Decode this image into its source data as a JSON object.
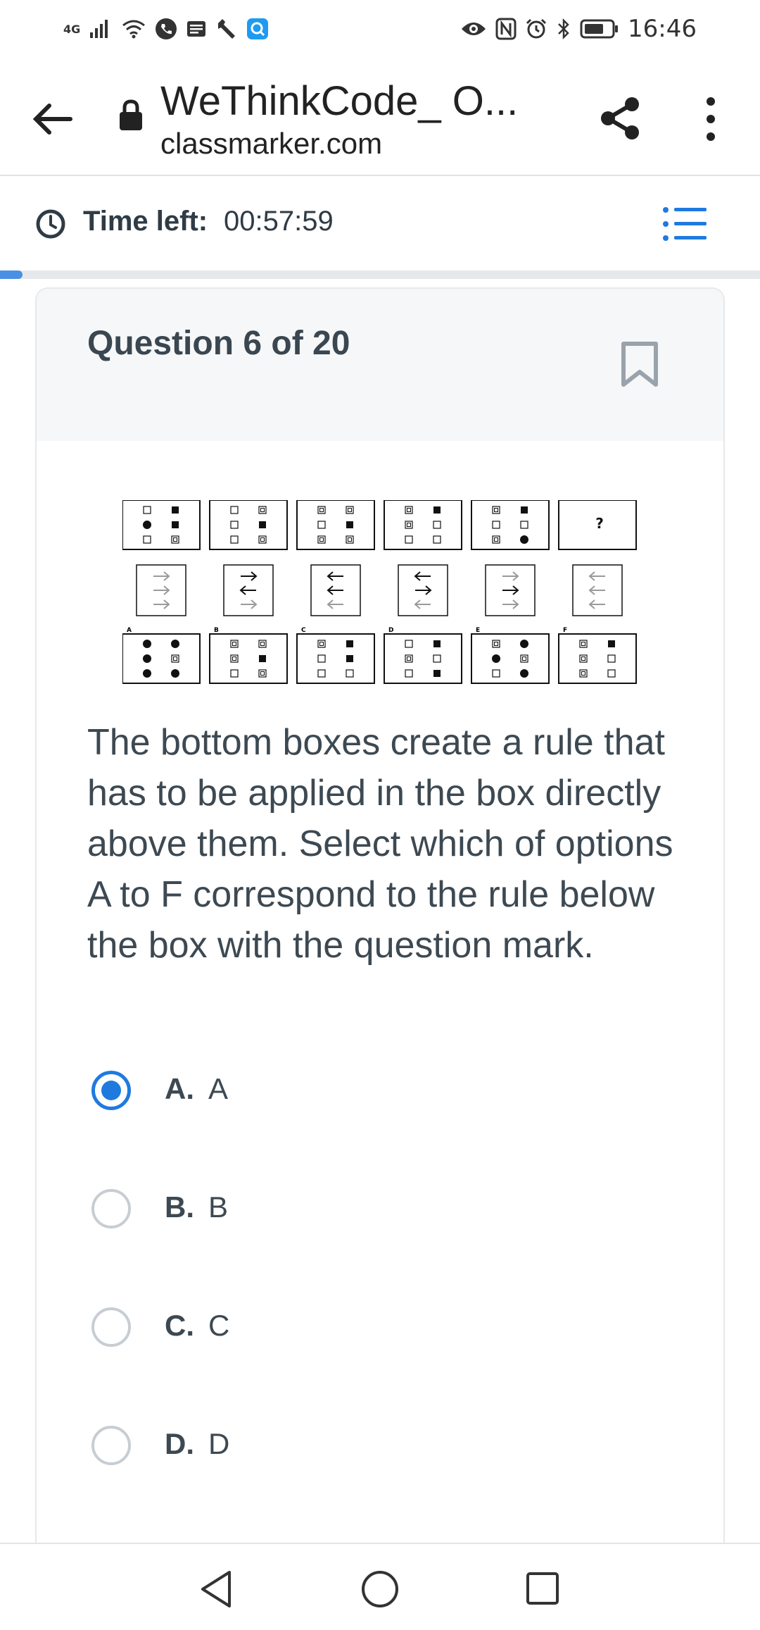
{
  "status_bar": {
    "network": "4G",
    "time": "16:46"
  },
  "app_bar": {
    "title": "WeThinkCode_ O...",
    "url": "classmarker.com"
  },
  "timer": {
    "label": "Time left:",
    "value": "00:57:59"
  },
  "progress": {
    "fraction": 0.03
  },
  "question": {
    "title": "Question 6 of 20",
    "text": "The bottom boxes create a rule that has to be applied in the box directly above them. Select which of options A to F correspond to the rule below the box with the question mark.",
    "puzzle": {
      "question_mark": "?",
      "option_labels": [
        "A",
        "B",
        "C",
        "D",
        "E",
        "F"
      ]
    }
  },
  "options": [
    {
      "letter": "A.",
      "text": "A",
      "selected": true
    },
    {
      "letter": "B.",
      "text": "B",
      "selected": false
    },
    {
      "letter": "C.",
      "text": "C",
      "selected": false
    },
    {
      "letter": "D.",
      "text": "D",
      "selected": false
    }
  ],
  "colors": {
    "accent": "#1f7ae0",
    "progress": "#4a90e2",
    "text": "#3d4952"
  }
}
